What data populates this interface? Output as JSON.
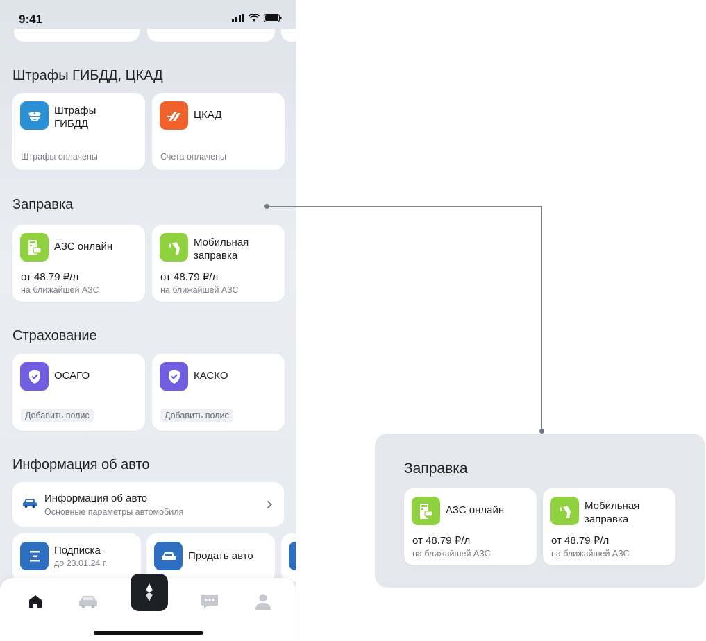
{
  "status_bar": {
    "time": "9:41"
  },
  "fines": {
    "title": "Штрафы ГИБДД, ЦКАД",
    "cards": [
      {
        "name_line1": "Штрафы",
        "name_line2": "ГИБДД",
        "status": "Штрафы оплачены",
        "icon": "police-cap-icon",
        "icon_color": "#2b8fd6"
      },
      {
        "name": "ЦКАД",
        "status": "Счета оплачены",
        "icon": "ckad-road-icon",
        "icon_color": "#f0622c"
      }
    ]
  },
  "fuel": {
    "title": "Заправка",
    "cards": [
      {
        "name": "АЗС онлайн",
        "price": "от 48.79 ₽/л",
        "note": "на ближайшей АЗС",
        "icon": "gas-station-icon",
        "icon_color": "#8fd13f"
      },
      {
        "name_line1": "Мобильная",
        "name_line2": "заправка",
        "price": "от 48.79 ₽/л",
        "note": "на ближайшей АЗС",
        "icon": "fuel-nozzle-icon",
        "icon_color": "#8fd13f"
      }
    ]
  },
  "insurance": {
    "title": "Страхование",
    "cards": [
      {
        "name": "ОСАГО",
        "action": "Добавить полис",
        "icon": "shield-check-icon",
        "icon_color": "#6f5fe0"
      },
      {
        "name": "КАСКО",
        "action": "Добавить полис",
        "icon": "shield-check-icon",
        "icon_color": "#6f5fe0"
      }
    ]
  },
  "car_info": {
    "title": "Информация об авто",
    "row_title": "Информация об авто",
    "row_desc": "Основные параметры автомобиля",
    "icon": "car-icon"
  },
  "bottom_cards": [
    {
      "title": "Подписка",
      "sub": "до 23.01.24 г.",
      "icon": "subscription-icon",
      "icon_color": "#2f6fc2"
    },
    {
      "title": "Продать авто",
      "icon": "car-sell-icon",
      "icon_color": "#2f6fc2"
    }
  ],
  "tabbar": {
    "items": [
      "home-icon",
      "car-tab-icon",
      "brand-logo-icon",
      "chat-icon",
      "profile-icon"
    ],
    "active": "home-icon"
  },
  "zoom_callout": {
    "title": "Заправка",
    "cards": [
      {
        "name": "АЗС онлайн",
        "price": "от 48.79 ₽/л",
        "note": "на ближайшей АЗС"
      },
      {
        "name_line1": "Мобильная",
        "name_line2": "заправка",
        "price": "от 48.79 ₽/л",
        "note": "на ближайшей АЗС"
      }
    ]
  },
  "colors": {
    "accent_green": "#8fd13f",
    "accent_orange": "#f0622c",
    "accent_blue": "#2b8fd6",
    "accent_purple": "#6f5fe0",
    "connector": "#7b8494"
  }
}
